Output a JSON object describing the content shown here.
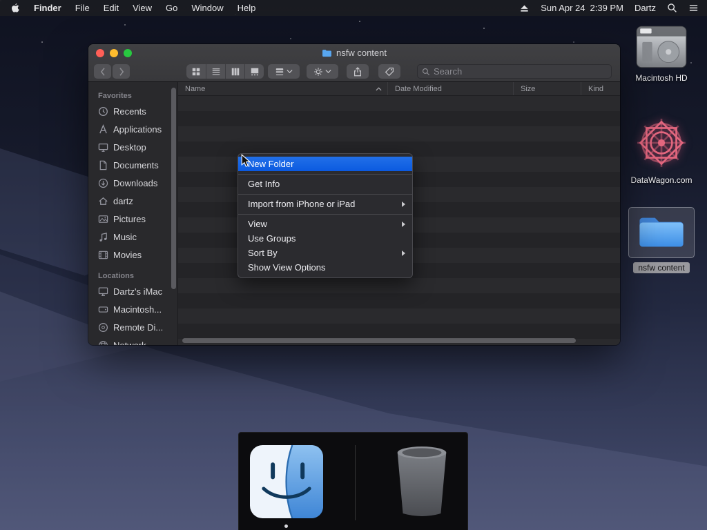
{
  "menubar": {
    "app_menu": "Finder",
    "items": [
      "File",
      "Edit",
      "View",
      "Go",
      "Window",
      "Help"
    ],
    "date": "Sun Apr 24",
    "time": "2:39 PM",
    "user": "Dartz"
  },
  "finder_window": {
    "title": "nsfw content",
    "search_placeholder": "Search",
    "sidebar": {
      "favorites_header": "Favorites",
      "favorites": [
        {
          "label": "Recents"
        },
        {
          "label": "Applications"
        },
        {
          "label": "Desktop"
        },
        {
          "label": "Documents"
        },
        {
          "label": "Downloads"
        },
        {
          "label": "dartz"
        },
        {
          "label": "Pictures"
        },
        {
          "label": "Music"
        },
        {
          "label": "Movies"
        }
      ],
      "locations_header": "Locations",
      "locations": [
        {
          "label": "Dartz's iMac"
        },
        {
          "label": "Macintosh..."
        },
        {
          "label": "Remote Di..."
        },
        {
          "label": "Network"
        }
      ]
    },
    "list_columns": [
      {
        "label": "Name"
      },
      {
        "label": "Date Modified"
      },
      {
        "label": "Size"
      },
      {
        "label": "Kind"
      }
    ]
  },
  "context_menu": {
    "items": [
      {
        "label": "New Folder"
      },
      {
        "label": "Get Info"
      },
      {
        "label": "Import from iPhone or iPad"
      },
      {
        "label": "View"
      },
      {
        "label": "Use Groups"
      },
      {
        "label": "Sort By"
      },
      {
        "label": "Show View Options"
      }
    ]
  },
  "desktop_icons": [
    {
      "label": "Macintosh HD"
    },
    {
      "label": "DataWagon.com"
    },
    {
      "label": "nsfw content"
    }
  ],
  "dock": {
    "apps": [
      {
        "name": "Finder"
      },
      {
        "name": "Trash"
      }
    ]
  },
  "colors": {
    "accent_blue": "#0b5ae0",
    "folder_blue": "#5aa3ef",
    "traffic_red": "#ff5f57",
    "traffic_yellow": "#febc2e",
    "traffic_green": "#28c840"
  }
}
